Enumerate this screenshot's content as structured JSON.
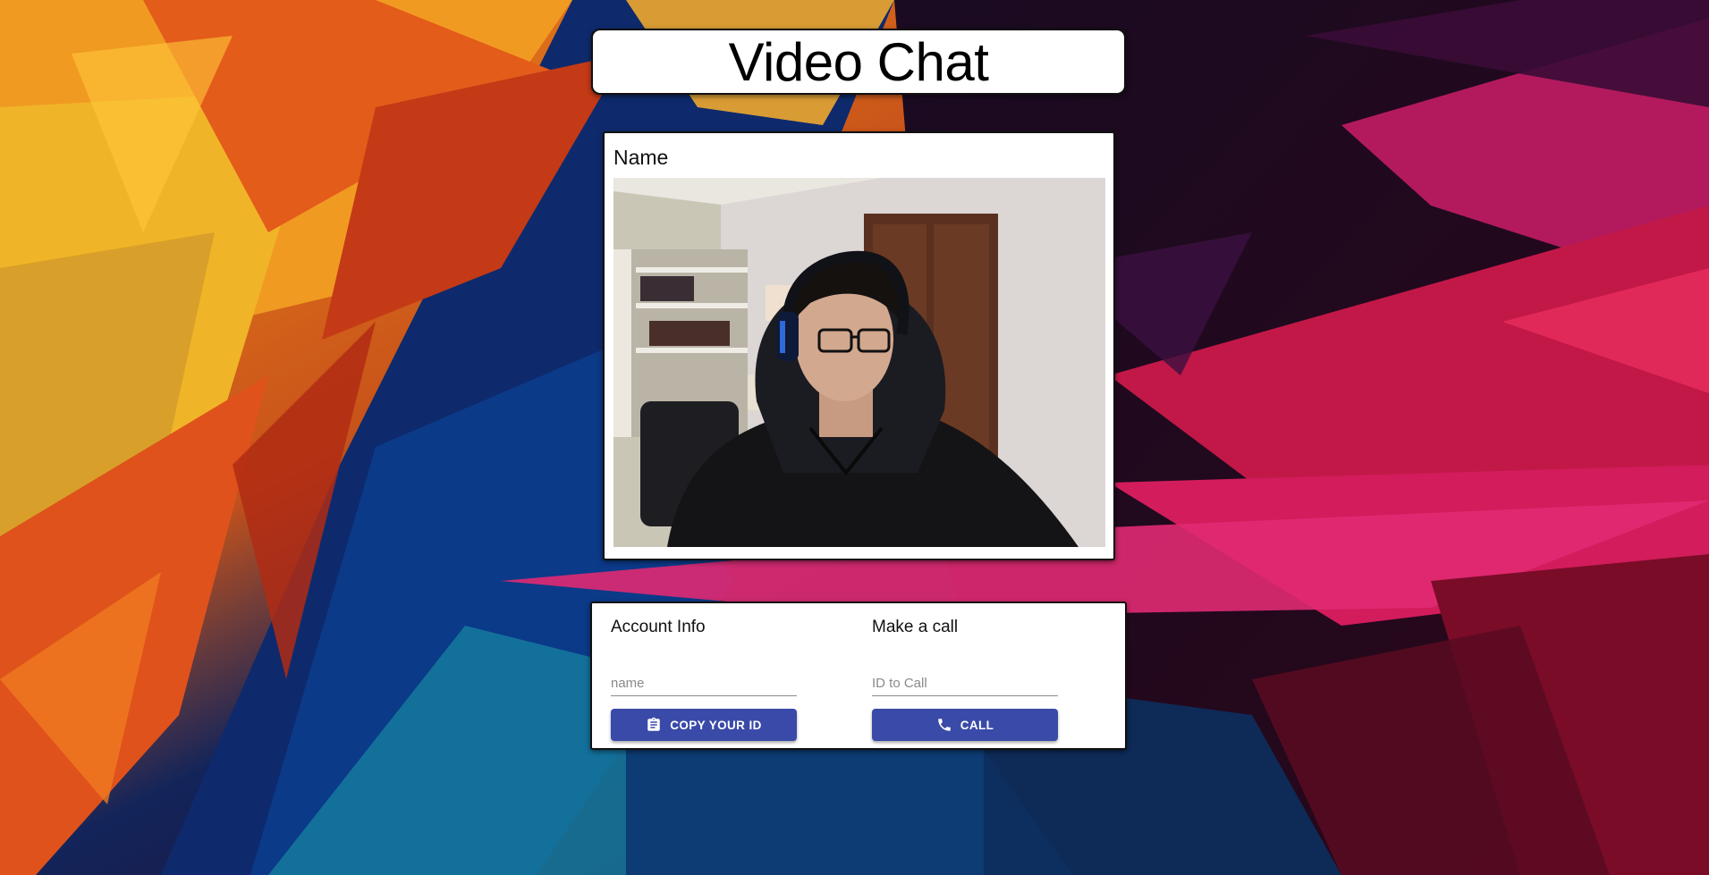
{
  "app": {
    "title": "Video Chat"
  },
  "video": {
    "name_label": "Name"
  },
  "account_info": {
    "heading": "Account Info",
    "name_placeholder": "name",
    "name_value": "",
    "copy_button_label": "COPY YOUR ID",
    "copy_button_icon": "clipboard-icon"
  },
  "make_call": {
    "heading": "Make a call",
    "id_placeholder": "ID to Call",
    "id_value": "",
    "call_button_label": "CALL",
    "call_button_icon": "phone-icon"
  },
  "colors": {
    "button": "#3a4aa8",
    "card": "#ffffff"
  }
}
